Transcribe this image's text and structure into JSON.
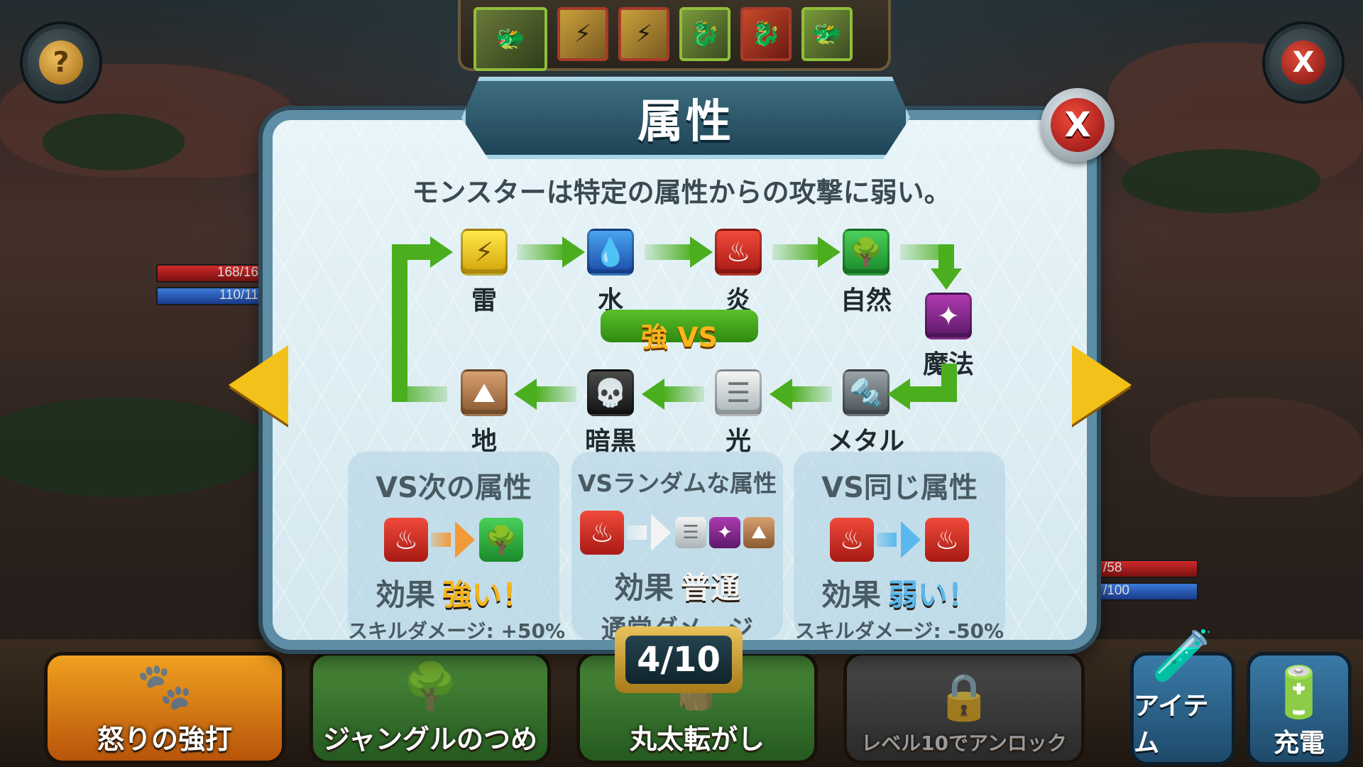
{
  "modal": {
    "title": "属性",
    "close_label": "X",
    "subtitle": "モンスターは特定の属性からの攻撃に弱い。",
    "vs_label": "強 VS",
    "pager": "4/10"
  },
  "elements": {
    "thunder": "雷",
    "water": "水",
    "fire": "炎",
    "nature": "自然",
    "magic": "魔法",
    "metal": "メタル",
    "light": "光",
    "dark": "暗黒",
    "earth": "地"
  },
  "panels": [
    {
      "title": "VS次の属性",
      "effect_label": "効果",
      "result": "強い！",
      "note": "スキルダメージ: +50%",
      "result_color": "#f7b51a"
    },
    {
      "title": "VSランダムな属性",
      "effect_label": "効果",
      "result": "普通",
      "note": "通常ダメージ",
      "result_color": "#f2f2f2"
    },
    {
      "title": "VS同じ属性",
      "effect_label": "効果",
      "result": "弱い！",
      "note": "スキルダメージ: -50%",
      "result_color": "#5ab8ee"
    }
  ],
  "hud": {
    "help_label": "?",
    "close_label": "X",
    "player_hp": "168/16",
    "player_mp": "110/11",
    "enemy_hp": "/58",
    "enemy_mp": "/100"
  },
  "skills": [
    {
      "label": "怒りの強打",
      "icon": "claw-icon"
    },
    {
      "label": "ジャングルのつめ",
      "icon": "tree-icon"
    },
    {
      "label": "丸太転がし",
      "icon": "log-icon"
    },
    {
      "label": "レベル10でアンロック",
      "icon": "lock-icon"
    }
  ],
  "buttons": {
    "items": "アイテム",
    "charge": "充電"
  },
  "colors": {
    "accent_green": "#4aae1e",
    "modal_border": "#5d8ea5",
    "nav_yellow": "#f2c21a"
  }
}
